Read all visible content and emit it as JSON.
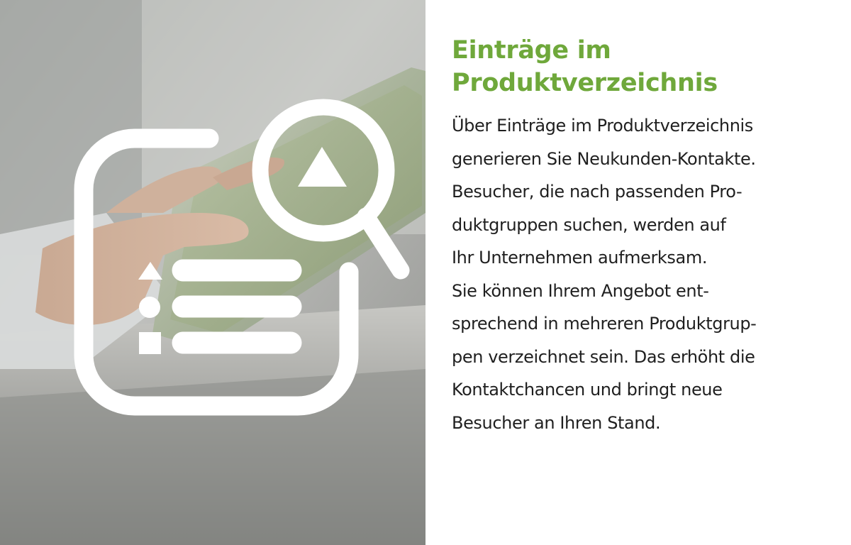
{
  "colors": {
    "accent": "#6fa83b",
    "text": "#1f1f1f",
    "icon": "#ffffff"
  },
  "icon": {
    "name": "product-directory-search-icon"
  },
  "heading": {
    "lines": [
      "Einträge im",
      "Produktverzeichnis"
    ]
  },
  "body": {
    "lines": [
      "Über Einträge im Produktverzeichnis",
      "generieren Sie Neukunden-Kontakte.",
      "Besucher, die nach passenden Pro-",
      "duktgruppen suchen, werden auf",
      "Ihr Unternehmen aufmerksam.",
      "Sie können Ihrem Angebot ent-",
      "sprechend in mehreren Produktgrup-",
      "pen verzeichnet sein. Das erhöht die",
      "Kontaktchancen und bringt neue",
      "Besucher an Ihren Stand."
    ]
  }
}
